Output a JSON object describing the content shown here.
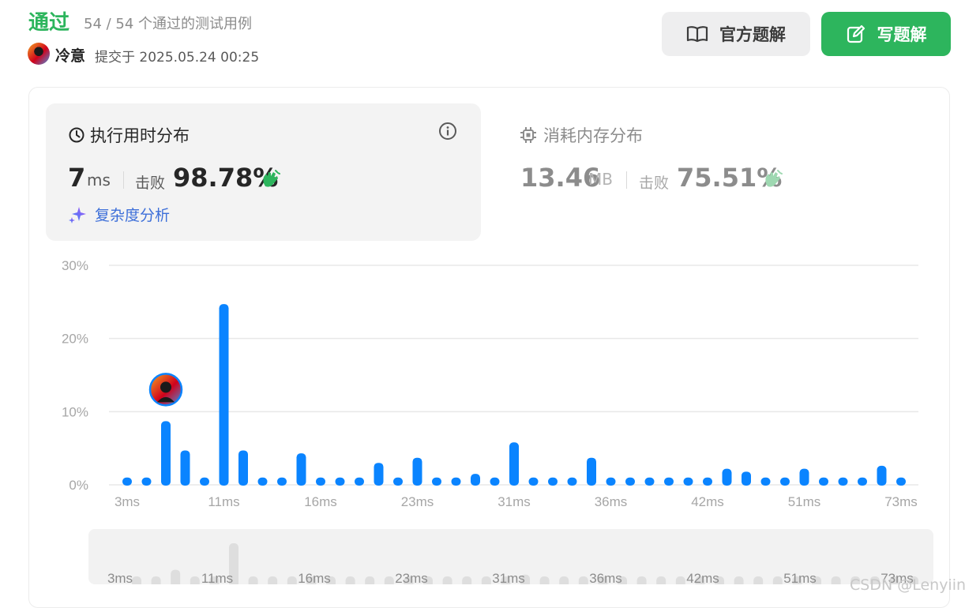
{
  "header": {
    "status": "通过",
    "case_count": "54 / 54 个通过的测试用例",
    "username": "冷意",
    "submit_info": "提交于 2025.05.24 00:25",
    "official_solution_label": "官方题解",
    "write_solution_label": "写题解"
  },
  "runtime": {
    "title": "执行用时分布",
    "value": "7",
    "unit": "ms",
    "beat_label": "击败",
    "beat_value": "98.78%",
    "complexity_label": "复杂度分析"
  },
  "memory": {
    "title": "消耗内存分布",
    "value": "13.46",
    "unit": "MB",
    "beat_label": "击败",
    "beat_value": "75.51%"
  },
  "colors": {
    "accent_green": "#2db55d",
    "bar_blue": "#0a84ff",
    "link_blue": "#3d6fd9",
    "complexity_purple": "#8b5cf6"
  },
  "icons": [
    "clock-icon",
    "info-icon",
    "sparkle-icon",
    "cpu-icon",
    "clap-icon",
    "book-icon",
    "edit-icon"
  ],
  "chart_data": {
    "type": "bar",
    "y_ticks": [
      "30%",
      "20%",
      "10%",
      "0%"
    ],
    "ylim": [
      0,
      30
    ],
    "x_tick_labels": [
      "3ms",
      "11ms",
      "16ms",
      "23ms",
      "31ms",
      "36ms",
      "42ms",
      "51ms",
      "73ms"
    ],
    "x_tick_bar_index": [
      0,
      5,
      10,
      15,
      20,
      25,
      30,
      35,
      40
    ],
    "values": [
      1.0,
      1.0,
      8.7,
      4.7,
      1.0,
      24.7,
      4.7,
      1.0,
      1.0,
      4.3,
      1.0,
      1.0,
      1.0,
      3.0,
      1.0,
      3.7,
      1.0,
      1.0,
      1.5,
      1.0,
      5.8,
      1.0,
      1.0,
      1.0,
      3.7,
      1.0,
      1.0,
      1.0,
      1.0,
      1.0,
      1.0,
      2.2,
      1.8,
      1.0,
      1.0,
      2.2,
      1.0,
      1.0,
      1.0,
      2.6,
      1.0
    ],
    "user_bar_index": 2
  },
  "watermark": "CSDN @Lenyiin"
}
